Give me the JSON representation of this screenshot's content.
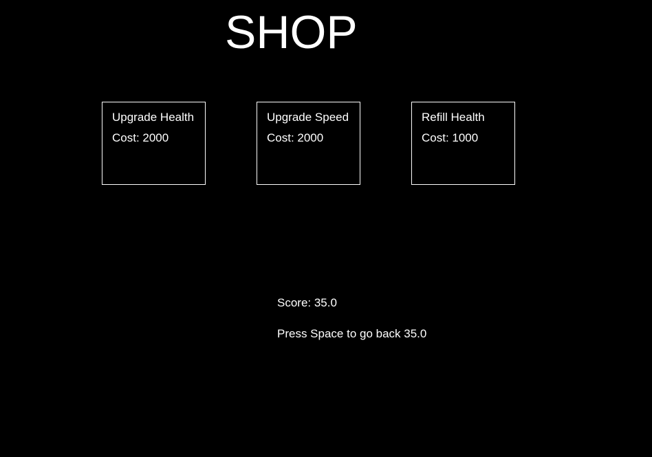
{
  "title": "SHOP",
  "items": [
    {
      "name": "Upgrade Health",
      "cost": "Cost: 2000"
    },
    {
      "name": "Upgrade Speed",
      "cost": "Cost: 2000"
    },
    {
      "name": "Refill Health",
      "cost": "Cost: 1000"
    }
  ],
  "score": "Score: 35.0",
  "back_hint": "Press Space to go back 35.0",
  "colors": {
    "background": "#000000",
    "text": "#ffffff",
    "border": "#ffffff"
  }
}
